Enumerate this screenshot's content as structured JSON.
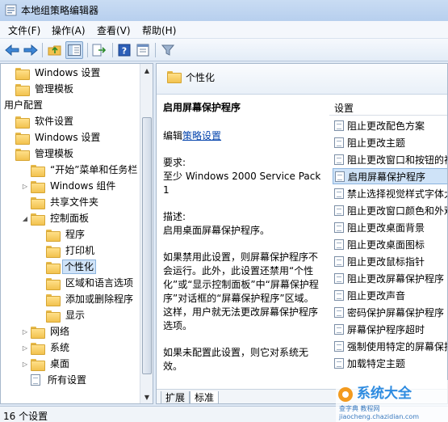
{
  "window": {
    "title": "本地组策略编辑器"
  },
  "menu": [
    "文件(F)",
    "操作(A)",
    "查看(V)",
    "帮助(H)"
  ],
  "toolbar": [
    "back-icon",
    "forward-icon",
    "up-folder-icon",
    "show-hide-tree-icon",
    "export-list-icon",
    "help-icon",
    "properties-icon",
    "filter-icon"
  ],
  "tree": [
    {
      "label": "Windows 设置",
      "depth": 0,
      "icon": "folder",
      "expander": ""
    },
    {
      "label": "管理模板",
      "depth": 0,
      "icon": "folder",
      "expander": ""
    },
    {
      "label": "用户配置",
      "depth": -1,
      "icon": "none",
      "expander": ""
    },
    {
      "label": "软件设置",
      "depth": 0,
      "icon": "folder",
      "expander": ""
    },
    {
      "label": "Windows 设置",
      "depth": 0,
      "icon": "folder",
      "expander": ""
    },
    {
      "label": "管理模板",
      "depth": 0,
      "icon": "folder",
      "expander": ""
    },
    {
      "label": "“开始”菜单和任务栏",
      "depth": 1,
      "icon": "folder",
      "expander": ""
    },
    {
      "label": "Windows 组件",
      "depth": 1,
      "icon": "folder",
      "expander": "▷"
    },
    {
      "label": "共享文件夹",
      "depth": 1,
      "icon": "folder",
      "expander": ""
    },
    {
      "label": "控制面板",
      "depth": 1,
      "icon": "folder",
      "expander": "◢"
    },
    {
      "label": "程序",
      "depth": 2,
      "icon": "folder",
      "expander": ""
    },
    {
      "label": "打印机",
      "depth": 2,
      "icon": "folder",
      "expander": ""
    },
    {
      "label": "个性化",
      "depth": 2,
      "icon": "folder",
      "expander": "",
      "selected": true
    },
    {
      "label": "区域和语言选项",
      "depth": 2,
      "icon": "folder",
      "expander": ""
    },
    {
      "label": "添加或删除程序",
      "depth": 2,
      "icon": "folder",
      "expander": ""
    },
    {
      "label": "显示",
      "depth": 2,
      "icon": "folder",
      "expander": ""
    },
    {
      "label": "网络",
      "depth": 1,
      "icon": "folder",
      "expander": "▷"
    },
    {
      "label": "系统",
      "depth": 1,
      "icon": "folder",
      "expander": "▷"
    },
    {
      "label": "桌面",
      "depth": 1,
      "icon": "folder",
      "expander": "▷"
    },
    {
      "label": "所有设置",
      "depth": 1,
      "icon": "doc",
      "expander": ""
    }
  ],
  "right": {
    "header_title": "个性化",
    "policy_title": "启用屏幕保护程序",
    "edit_prefix": "编辑",
    "edit_link": "策略设置",
    "req_label": "要求:",
    "req_value": "至少 Windows 2000 Service Pack 1",
    "desc_label": "描述:",
    "desc_value": "启用桌面屏幕保护程序。",
    "para1": "如果禁用此设置，则屏幕保护程序不会运行。此外，此设置还禁用“个性化”或“显示控制面板”中“屏幕保护程序”对话框的“屏幕保护程序”区域。这样，用户就无法更改屏幕保护程序选项。",
    "para2": "如果未配置此设置，则它对系统无效。",
    "list_header": "设置",
    "settings": [
      "阻止更改配色方案",
      "阻止更改主题",
      "阻止更改窗口和按钮的视觉样式",
      "启用屏幕保护程序",
      "禁止选择视觉样式字体大小",
      "阻止更改窗口颜色和外观",
      "阻止更改桌面背景",
      "阻止更改桌面图标",
      "阻止更改鼠标指针",
      "阻止更改屏幕保护程序",
      "阻止更改声音",
      "密码保护屏幕保护程序",
      "屏幕保护程序超时",
      "强制使用特定的屏幕保护程序",
      "加载特定主题"
    ],
    "selected_index": 3,
    "tabs": [
      "扩展",
      "标准"
    ]
  },
  "status": {
    "text": "16 个设置"
  },
  "watermark": {
    "main": "系统大全",
    "sub": "查字典 教程网",
    "url": "jiaocheng.chazidian.com"
  },
  "colors": {
    "accent": "#cfe3f8",
    "link": "#0645ad",
    "window": "#dfe9f5"
  }
}
